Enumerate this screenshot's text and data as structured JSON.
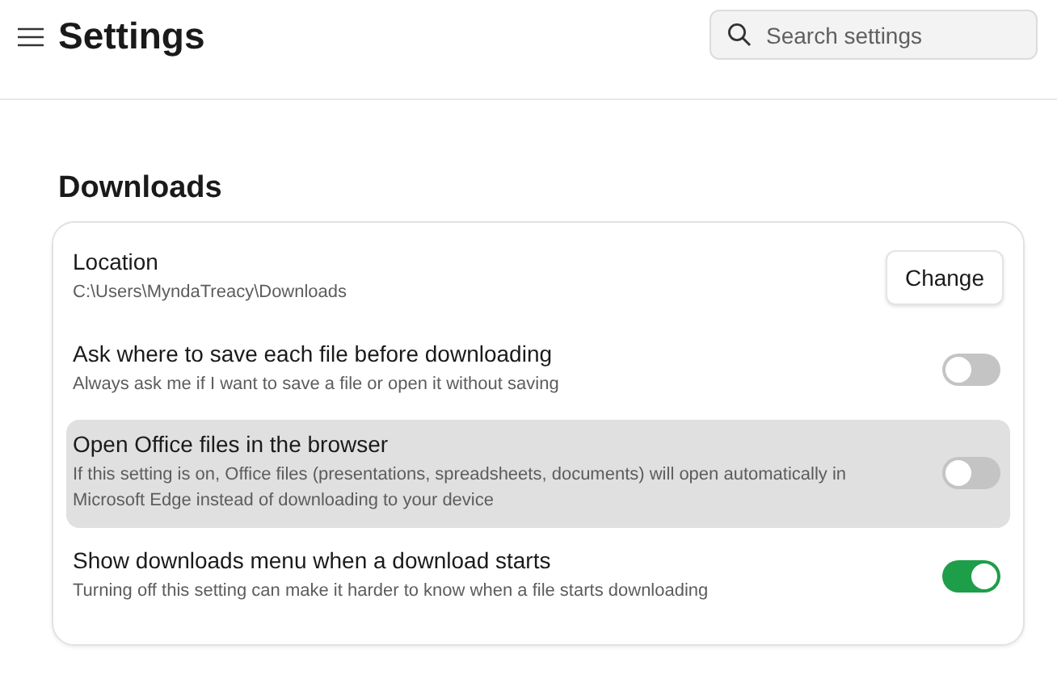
{
  "header": {
    "title": "Settings",
    "search": {
      "placeholder": "Search settings"
    }
  },
  "section": {
    "title": "Downloads",
    "rows": [
      {
        "kind": "button",
        "title": "Location",
        "description": "C:\\Users\\MyndaTreacy\\Downloads",
        "button": "Change",
        "highlighted": false
      },
      {
        "kind": "toggle",
        "title": "Ask where to save each file before downloading",
        "description": "Always ask me if I want to save a file or open it without saving",
        "on": false,
        "highlighted": false
      },
      {
        "kind": "toggle",
        "title": "Open Office files in the browser",
        "description": "If this setting is on, Office files (presentations, spreadsheets, documents) will open automatically in Microsoft Edge instead of downloading to your device",
        "on": false,
        "highlighted": true
      },
      {
        "kind": "toggle",
        "title": "Show downloads menu when a download starts",
        "description": "Turning off this setting can make it harder to know when a file starts downloading",
        "on": true,
        "highlighted": false
      }
    ]
  }
}
